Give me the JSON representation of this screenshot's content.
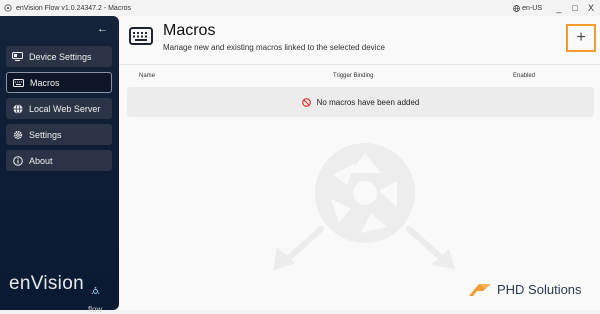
{
  "window": {
    "title": "enVision Flow v1.0.24347.2 - Macros",
    "language": "en-US",
    "minimize": "_",
    "maximize": "□",
    "close": "X"
  },
  "sidebar": {
    "back_icon": "arrow-left-icon",
    "items": [
      {
        "label": "Device Settings",
        "icon": "device-icon",
        "active": false
      },
      {
        "label": "Macros",
        "icon": "keyboard-icon",
        "active": true
      },
      {
        "label": "Local Web Server",
        "icon": "globe-icon",
        "active": false
      },
      {
        "label": "Settings",
        "icon": "gear-icon",
        "active": false
      },
      {
        "label": "About",
        "icon": "info-icon",
        "active": false
      }
    ],
    "logo_text": "enVision",
    "logo_sub": "flow"
  },
  "header": {
    "title": "Macros",
    "subtitle": "Manage new and existing macros linked to the selected device",
    "add_label": "+"
  },
  "table": {
    "columns": [
      "Name",
      "Trigger Binding",
      "Enabled"
    ],
    "empty_message": "No macros have been added"
  },
  "brand": {
    "name": "PHD Solutions"
  },
  "colors": {
    "accent": "#f29b31",
    "sidebar_bg": "#0f1e36",
    "error": "#d9342b"
  }
}
